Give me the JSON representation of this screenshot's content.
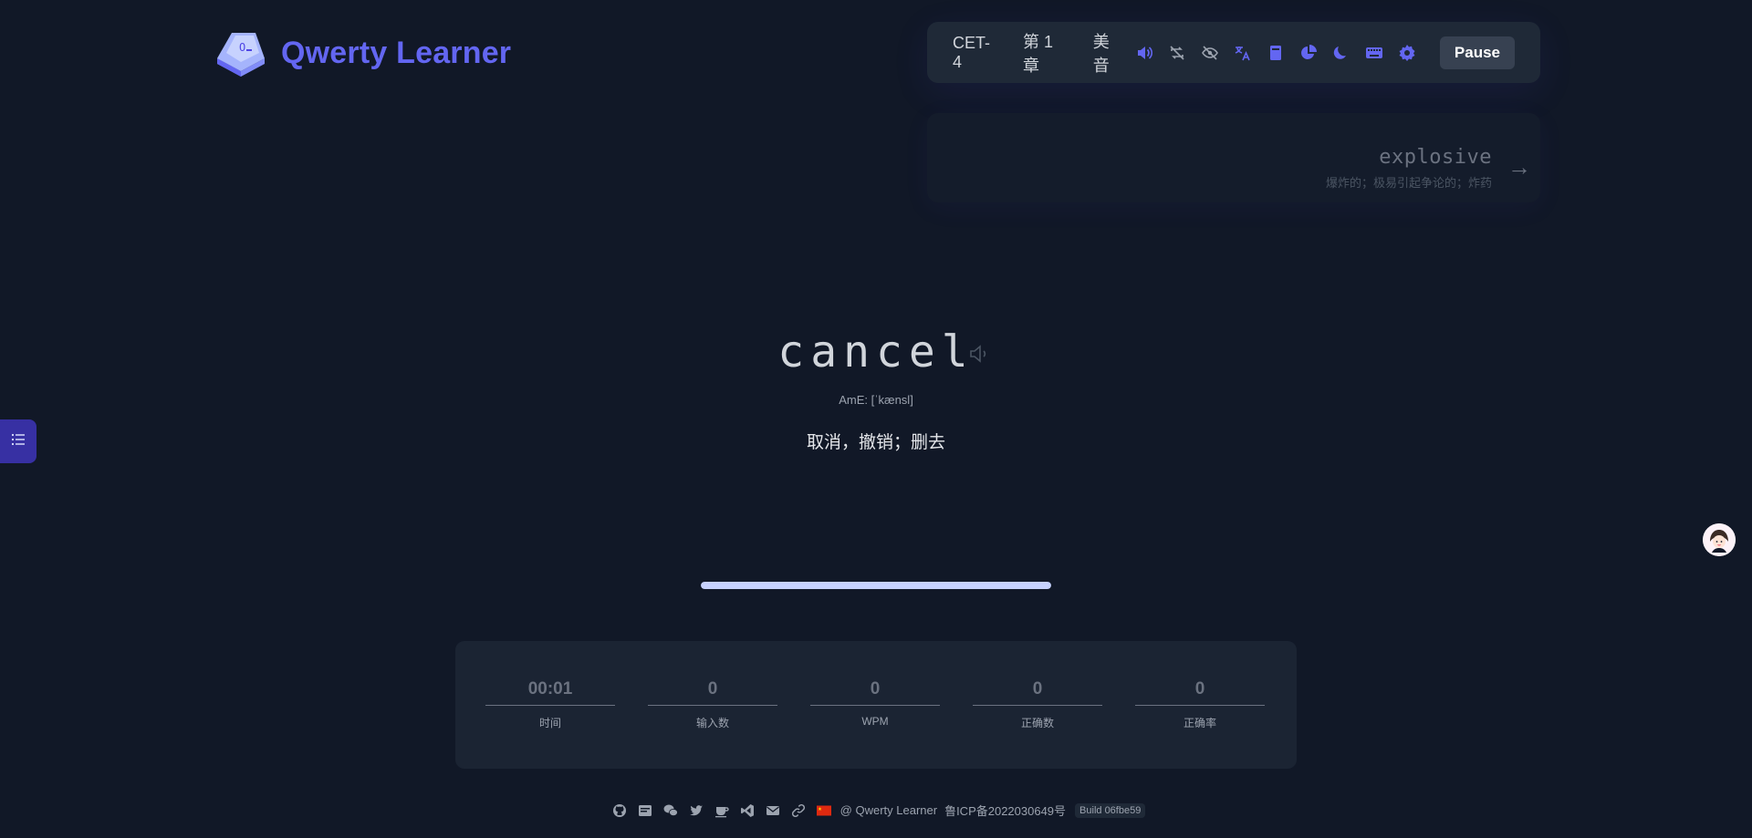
{
  "app": {
    "title": "Qwerty Learner"
  },
  "toolbar": {
    "dictionary": "CET-4",
    "chapter": "第 1 章",
    "accent": "美音",
    "icons": [
      "sound-icon",
      "loop-icon",
      "hide-word-icon",
      "translation-icon",
      "dictionary-book-icon",
      "analysis-chart-icon",
      "dark-mode-icon",
      "keyboard-icon",
      "settings-gear-icon"
    ],
    "pause_label": "Pause"
  },
  "next_word": {
    "word": "explosive",
    "translation": "爆炸的；极易引起争论的；炸药"
  },
  "current_word": {
    "word": "cancel",
    "phonetic": "AmE: [ˈkænsl]",
    "translation": "取消，撤销；删去"
  },
  "progress": {
    "fraction": 1.0
  },
  "stats": [
    {
      "value": "00:01",
      "label": "时间"
    },
    {
      "value": "0",
      "label": "输入数"
    },
    {
      "value": "0",
      "label": "WPM"
    },
    {
      "value": "0",
      "label": "正确数"
    },
    {
      "value": "0",
      "label": "正确率"
    }
  ],
  "footer": {
    "icons": [
      "github-icon",
      "blog-icon",
      "wechat-icon",
      "twitter-icon",
      "coffee-icon",
      "vscode-icon",
      "mail-icon",
      "link-icon",
      "china-flag-icon"
    ],
    "copyright": "@ Qwerty Learner",
    "icp": "鲁ICP备2022030649号",
    "build": "Build 06fbe59"
  },
  "colors": {
    "accent": "#6366f1",
    "background": "#111827",
    "panel": "#1f2937"
  }
}
